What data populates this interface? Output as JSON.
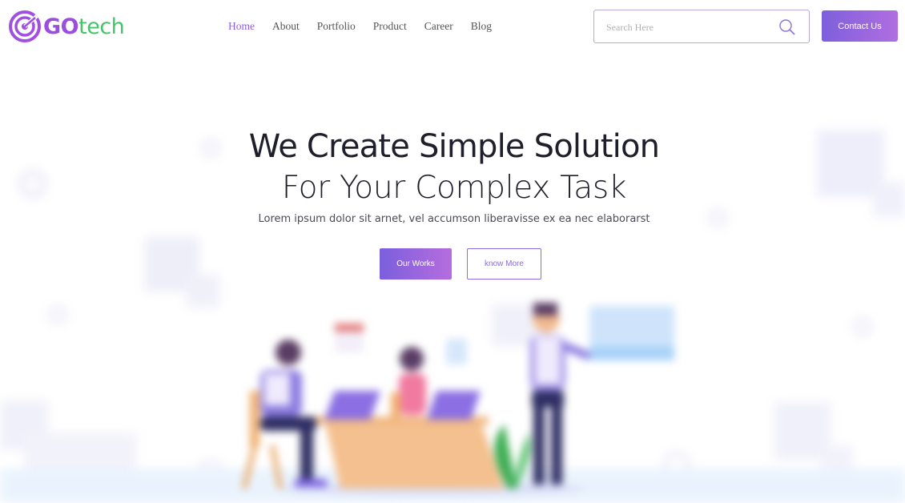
{
  "brand": {
    "logo_prefix": "GO",
    "logo_suffix": "tech",
    "prefix_color": "#9b4de0",
    "suffix_color": "#47c46b"
  },
  "nav": {
    "items": [
      {
        "label": "Home",
        "active": true
      },
      {
        "label": "About",
        "active": false
      },
      {
        "label": "Portfolio",
        "active": false
      },
      {
        "label": "Product",
        "active": false
      },
      {
        "label": "Career",
        "active": false
      },
      {
        "label": "Blog",
        "active": false
      }
    ]
  },
  "search": {
    "placeholder": "Search Here",
    "icon": "search-icon"
  },
  "header": {
    "contact_label": "Contact Us"
  },
  "hero": {
    "title_line1": "We Create Simple Solution",
    "title_line2": "For Your Complex Task",
    "subtitle": "Lorem ipsum dolor sit arnet, vel accumson liberavisse ex ea nec elaborarst",
    "primary_button": "Our Works",
    "secondary_button": "know More"
  },
  "colors": {
    "accent": "#8a6be0",
    "accent_gradient_start": "#7b5fdd",
    "accent_gradient_end": "#b56ddd",
    "title": "#1f1f2b"
  }
}
